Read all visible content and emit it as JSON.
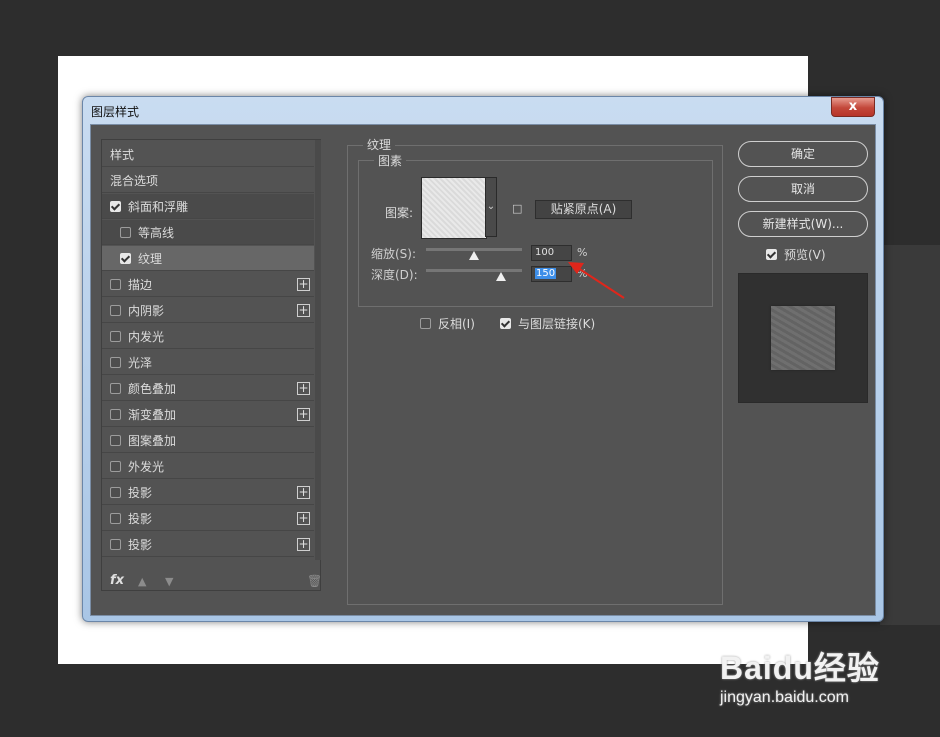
{
  "window": {
    "title": "图层样式",
    "close_label": "x"
  },
  "style_list": {
    "items": [
      {
        "label": "样式",
        "checkbox": false,
        "checked": false,
        "plus": false,
        "indent": 0,
        "state": "normal"
      },
      {
        "label": "混合选项",
        "checkbox": false,
        "checked": false,
        "plus": false,
        "indent": 0,
        "state": "normal"
      },
      {
        "label": "斜面和浮雕",
        "checkbox": true,
        "checked": true,
        "plus": false,
        "indent": 0,
        "state": "dark"
      },
      {
        "label": "等高线",
        "checkbox": true,
        "checked": false,
        "plus": false,
        "indent": 1,
        "state": "dark"
      },
      {
        "label": "纹理",
        "checkbox": true,
        "checked": true,
        "plus": false,
        "indent": 1,
        "state": "selected"
      },
      {
        "label": "描边",
        "checkbox": true,
        "checked": false,
        "plus": true,
        "indent": 0,
        "state": "normal"
      },
      {
        "label": "内阴影",
        "checkbox": true,
        "checked": false,
        "plus": true,
        "indent": 0,
        "state": "normal"
      },
      {
        "label": "内发光",
        "checkbox": true,
        "checked": false,
        "plus": false,
        "indent": 0,
        "state": "normal"
      },
      {
        "label": "光泽",
        "checkbox": true,
        "checked": false,
        "plus": false,
        "indent": 0,
        "state": "normal"
      },
      {
        "label": "颜色叠加",
        "checkbox": true,
        "checked": false,
        "plus": true,
        "indent": 0,
        "state": "normal"
      },
      {
        "label": "渐变叠加",
        "checkbox": true,
        "checked": false,
        "plus": true,
        "indent": 0,
        "state": "normal"
      },
      {
        "label": "图案叠加",
        "checkbox": true,
        "checked": false,
        "plus": false,
        "indent": 0,
        "state": "normal"
      },
      {
        "label": "外发光",
        "checkbox": true,
        "checked": false,
        "plus": false,
        "indent": 0,
        "state": "normal"
      },
      {
        "label": "投影",
        "checkbox": true,
        "checked": false,
        "plus": true,
        "indent": 0,
        "state": "normal"
      },
      {
        "label": "投影",
        "checkbox": true,
        "checked": false,
        "plus": true,
        "indent": 0,
        "state": "normal"
      },
      {
        "label": "投影",
        "checkbox": true,
        "checked": false,
        "plus": true,
        "indent": 0,
        "state": "normal"
      }
    ],
    "footer": {
      "fx_label": "fx",
      "icons": [
        "move-up-icon",
        "move-down-icon",
        "trash-icon"
      ]
    }
  },
  "texture": {
    "section_title": "纹理",
    "pattern_group_title": "图素",
    "pattern_label": "图案:",
    "snap_button": "贴紧原点(A)",
    "scale": {
      "label": "缩放(S):",
      "value": "100",
      "unit": "%",
      "slider_fraction": 0.5
    },
    "depth": {
      "label": "深度(D):",
      "value": "150",
      "unit": "%",
      "slider_fraction": 0.78
    },
    "invert": {
      "label": "反相(I)",
      "checked": false
    },
    "link": {
      "label": "与图层链接(K)",
      "checked": true
    }
  },
  "buttons": {
    "ok": "确定",
    "cancel": "取消",
    "new_style": "新建样式(W)..."
  },
  "preview": {
    "label": "预览(V)",
    "checked": true
  },
  "colors": {
    "panel": "#535353",
    "selection": "#3d8ee8",
    "annotation_arrow": "#e0261b"
  },
  "watermark": {
    "logo": "Baidu经验",
    "url": "jingyan.baidu.com"
  }
}
